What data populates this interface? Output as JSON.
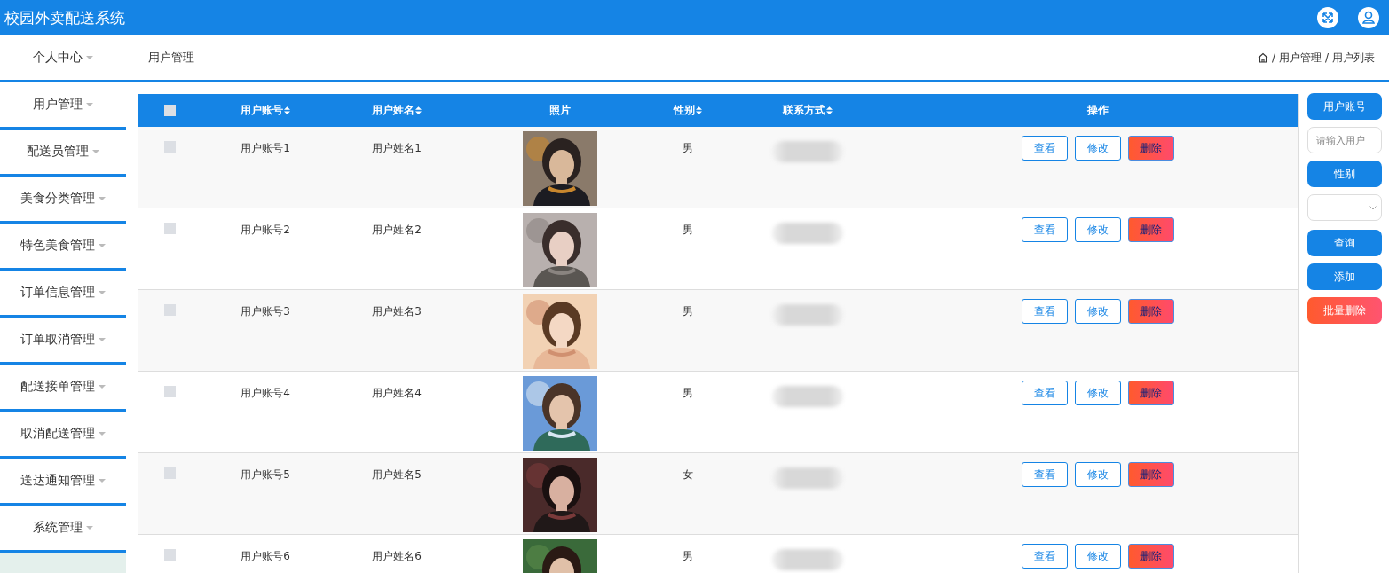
{
  "app": {
    "title": "校园外卖配送系统"
  },
  "top_nav": {
    "menu": {
      "label": "个人中心"
    },
    "page_title": "用户管理",
    "breadcrumb": [
      {
        "separator": "/",
        "label": "用户管理"
      },
      {
        "separator": "/",
        "label": "用户列表"
      }
    ]
  },
  "sidebar": {
    "items": [
      {
        "label": "用户管理"
      },
      {
        "label": "配送员管理"
      },
      {
        "label": "美食分类管理"
      },
      {
        "label": "特色美食管理"
      },
      {
        "label": "订单信息管理"
      },
      {
        "label": "订单取消管理"
      },
      {
        "label": "配送接单管理"
      },
      {
        "label": "取消配送管理"
      },
      {
        "label": "送达通知管理"
      },
      {
        "label": "系统管理"
      }
    ]
  },
  "table": {
    "select_all": {
      "checked": false
    },
    "columns": [
      {
        "label": "用户账号",
        "sortable": true
      },
      {
        "label": "用户姓名",
        "sortable": true
      },
      {
        "label": "照片",
        "sortable": false
      },
      {
        "label": "性别",
        "sortable": true
      },
      {
        "label": "联系方式",
        "sortable": true
      },
      {
        "label": "操作",
        "sortable": false
      }
    ],
    "rows": [
      {
        "checked": false,
        "account": "用户账号1",
        "name": "用户姓名1",
        "gender": "男",
        "actions": [
          {
            "label": "查看",
            "kind": "outline"
          },
          {
            "label": "修改",
            "kind": "outline"
          },
          {
            "label": "删除",
            "kind": "danger"
          }
        ]
      },
      {
        "checked": false,
        "account": "用户账号2",
        "name": "用户姓名2",
        "gender": "男",
        "actions": [
          {
            "label": "查看",
            "kind": "outline"
          },
          {
            "label": "修改",
            "kind": "outline"
          },
          {
            "label": "删除",
            "kind": "danger"
          }
        ]
      },
      {
        "checked": false,
        "account": "用户账号3",
        "name": "用户姓名3",
        "gender": "男",
        "actions": [
          {
            "label": "查看",
            "kind": "outline"
          },
          {
            "label": "修改",
            "kind": "outline"
          },
          {
            "label": "删除",
            "kind": "danger"
          }
        ]
      },
      {
        "checked": false,
        "account": "用户账号4",
        "name": "用户姓名4",
        "gender": "男",
        "actions": [
          {
            "label": "查看",
            "kind": "outline"
          },
          {
            "label": "修改",
            "kind": "outline"
          },
          {
            "label": "删除",
            "kind": "danger"
          }
        ]
      },
      {
        "checked": false,
        "account": "用户账号5",
        "name": "用户姓名5",
        "gender": "女",
        "actions": [
          {
            "label": "查看",
            "kind": "outline"
          },
          {
            "label": "修改",
            "kind": "outline"
          },
          {
            "label": "删除",
            "kind": "danger"
          }
        ]
      },
      {
        "checked": false,
        "account": "用户账号6",
        "name": "用户姓名6",
        "gender": "男",
        "actions": [
          {
            "label": "查看",
            "kind": "outline"
          },
          {
            "label": "修改",
            "kind": "outline"
          },
          {
            "label": "删除",
            "kind": "danger"
          }
        ]
      }
    ]
  },
  "search_panel": [
    {
      "kind": "label",
      "text": "用户账号"
    },
    {
      "kind": "input",
      "placeholder": "请输入用户"
    },
    {
      "kind": "label",
      "text": "性别"
    },
    {
      "kind": "select"
    },
    {
      "kind": "primary",
      "text": "查询"
    },
    {
      "kind": "primary",
      "text": "添加"
    },
    {
      "kind": "danger",
      "text": "批量删除"
    }
  ]
}
